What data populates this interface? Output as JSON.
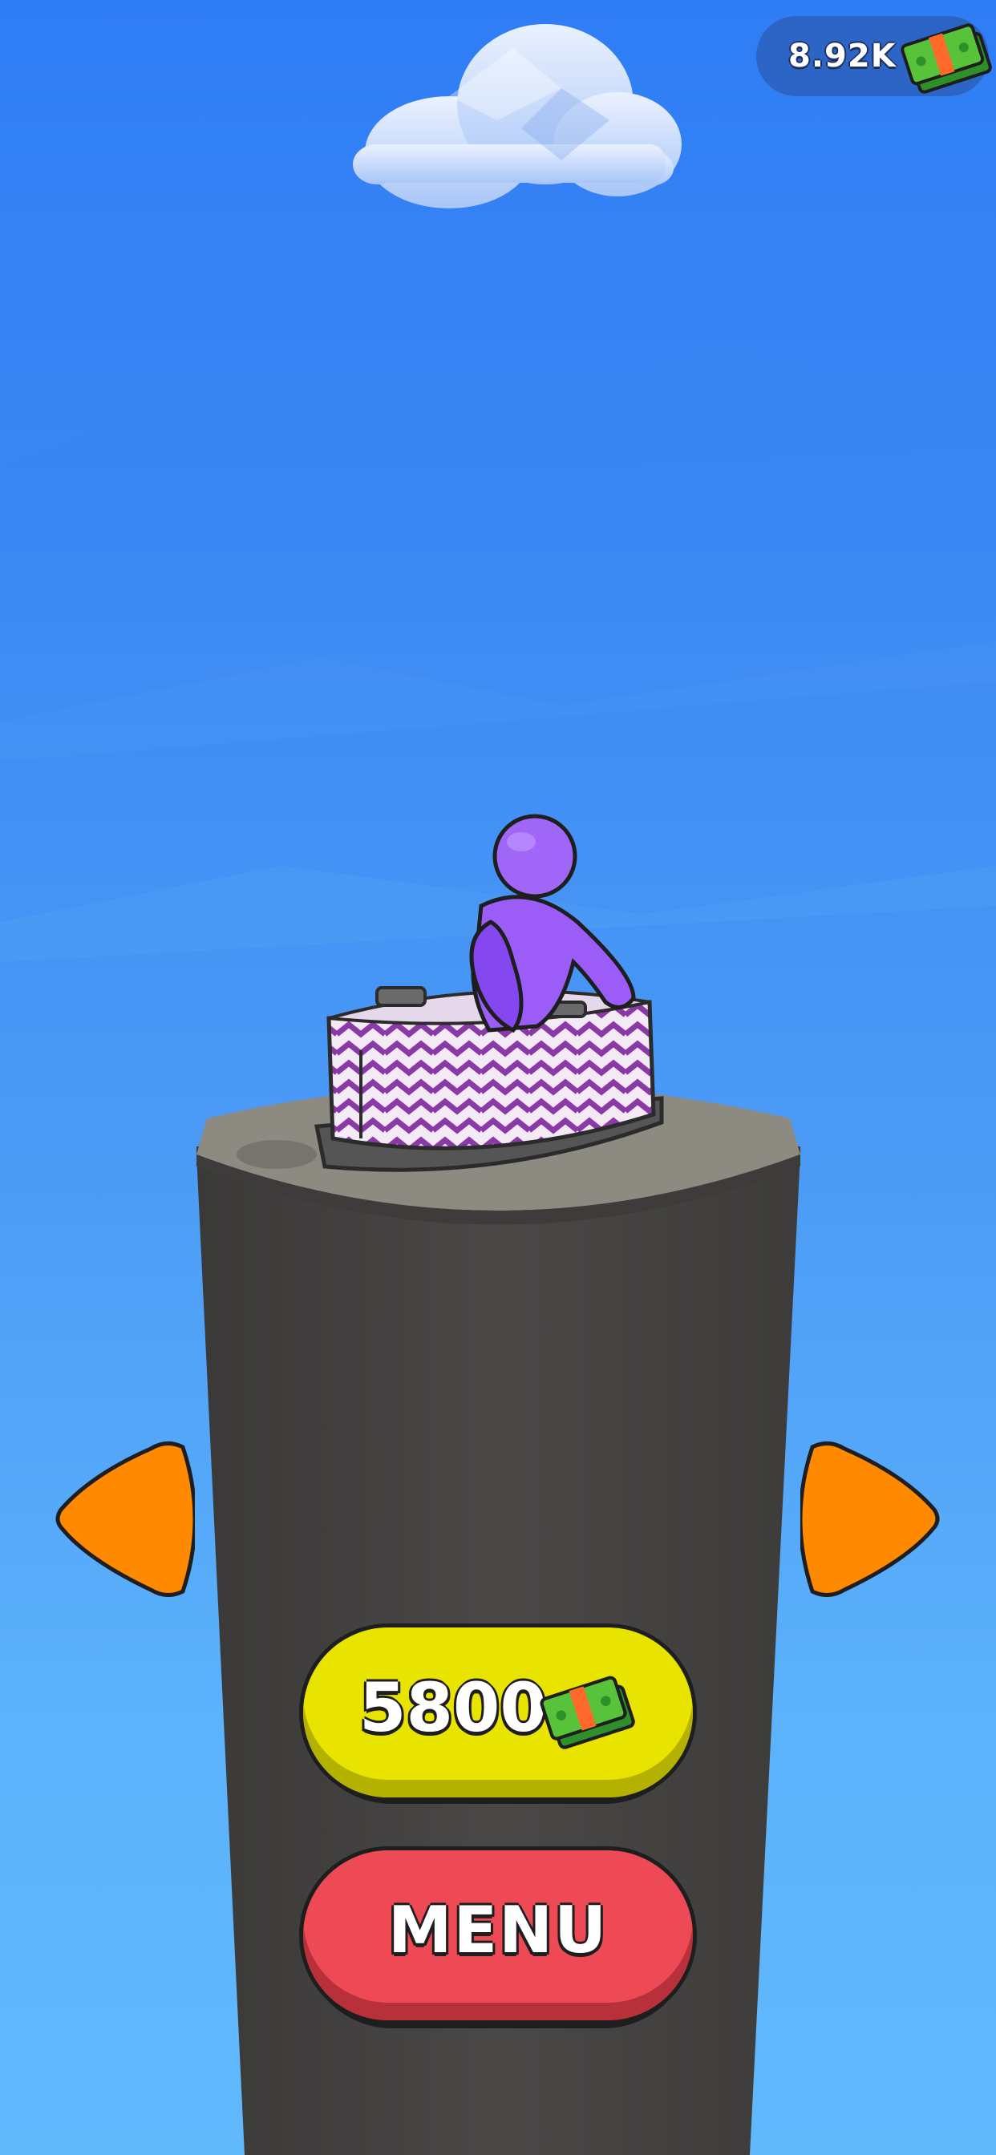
{
  "hud": {
    "currency_value": "8.92K",
    "currency_icon": "cash-stack-icon"
  },
  "controls": {
    "prev_icon": "arrow-left-icon",
    "next_icon": "arrow-right-icon",
    "price_value": "5800",
    "price_icon": "cash-stack-icon",
    "menu_label": "MENU"
  },
  "colors": {
    "sky_top": "#2f7df5",
    "sky_bottom": "#61b9fc",
    "arrow": "#ff8a00",
    "price_button": "#e9e300",
    "menu_button": "#ee4a55",
    "character": "#9b5cf7",
    "pillar": "#4a4847",
    "pillar_top": "#8d8a82"
  }
}
